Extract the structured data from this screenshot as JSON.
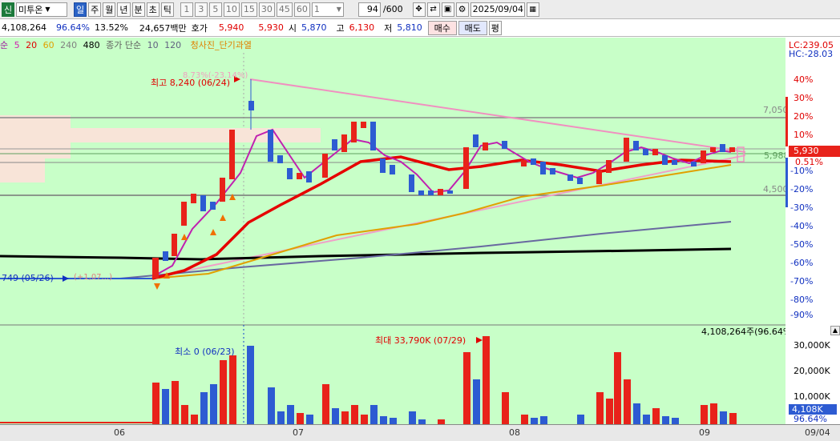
{
  "toolbar": {
    "market_tag": "신",
    "stock_name": "미투온",
    "periods": [
      "일",
      "주",
      "월",
      "년",
      "분",
      "초",
      "틱"
    ],
    "selected_period": "일",
    "numbers": [
      "1",
      "3",
      "5",
      "10",
      "15",
      "30",
      "45",
      "60"
    ],
    "unit_select": "1",
    "count": "94",
    "count_total": "/600",
    "date": "2025/09/04"
  },
  "quote": {
    "volume": "4,108,264",
    "vol_pct1": "96.64%",
    "vol_pct2": "13.52%",
    "amount": "24,657백만",
    "price_label": "호가",
    "ask": "5,940",
    "bid": "5,930",
    "open_label": "시",
    "open": "5,870",
    "high_label": "고",
    "high": "6,130",
    "low_label": "저",
    "low": "5,810",
    "buy_label": "매수",
    "sell_label": "매도",
    "eval_label": "평"
  },
  "legend": {
    "ma_label": "순",
    "ma5": "5",
    "ma20": "20",
    "ma60": "60",
    "ma240": "240",
    "ma480": "480",
    "close_label": "종가 단순",
    "ma10": "10",
    "ma120": "120",
    "signal": "청사진_단기과열"
  },
  "annotations": {
    "high_marker": "최고 8,240 (06/24)",
    "high_pct": "8.73%(-23.14%)",
    "low_price_marker": "749 (05/26)",
    "low_pct": "(+1,07...)",
    "vol_max": "최대 33,790K (07/29)",
    "vol_min": "최소 0 (06/23)",
    "vol_current": "4,108,264주(96.64%)",
    "level_7050": "7,050",
    "level_4500": "4,500",
    "level_5988": "5,988"
  },
  "right_axis": {
    "lc": "LC:239.05",
    "hc": "HC:-28.03",
    "pct_ticks": [
      "40%",
      "30%",
      "20%",
      "10%",
      "0%",
      "-10%",
      "-20%",
      "-30%",
      "-40%",
      "-50%",
      "-60%",
      "-70%",
      "-80%",
      "-90%"
    ],
    "current_price": "5,930",
    "current_pct": "0.51%",
    "vol_ticks": [
      "30,000K",
      "20,000K",
      "10,000K"
    ],
    "vol_current": "4,108K",
    "vol_current_pct": "96.64%"
  },
  "x_axis": [
    "06",
    "07",
    "08",
    "09",
    "09/04"
  ],
  "colors": {
    "up": "#e8221a",
    "down": "#2d5bd2",
    "bg": "#c8ffc8",
    "ma5": "#d020b0",
    "ma20": "#e00000",
    "ma60": "#e0a000",
    "ma240": "#707090",
    "ma480": "#000000"
  },
  "chart_data": {
    "type": "candlestick",
    "x_range": [
      "2025-05-26",
      "2025-09-04"
    ],
    "price_levels": [
      7050,
      5988,
      4500
    ],
    "volume_max": 33790000,
    "volume_current": 4108264,
    "current_price": 5930
  }
}
